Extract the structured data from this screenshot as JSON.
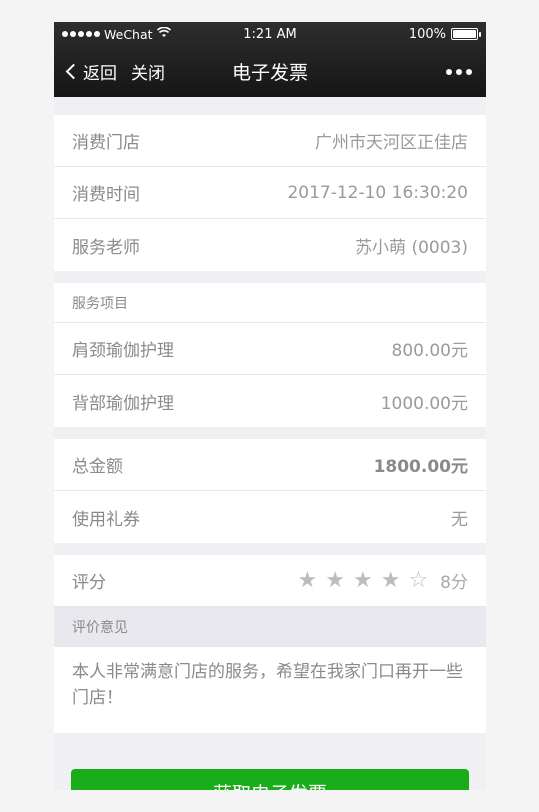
{
  "status_bar": {
    "carrier": "WeChat",
    "time": "1:21 AM",
    "battery": "100%"
  },
  "nav": {
    "back_label": "返回",
    "close_label": "关闭",
    "title": "电子发票"
  },
  "info": {
    "store_label": "消费门店",
    "store_value": "广州市天河区正佳店",
    "time_label": "消费时间",
    "time_value": "2017-12-10 16:30:20",
    "teacher_label": "服务老师",
    "teacher_value": "苏小萌 (0003)"
  },
  "services": {
    "header": "服务项目",
    "items": [
      {
        "name": "肩颈瑜伽护理",
        "price": "800.00元"
      },
      {
        "name": "背部瑜伽护理",
        "price": "1000.00元"
      }
    ]
  },
  "totals": {
    "total_label": "总金额",
    "total_value": "1800.00元",
    "coupon_label": "使用礼券",
    "coupon_value": "无"
  },
  "rating": {
    "label": "评分",
    "stars_filled": 4,
    "stars_total": 5,
    "score": "8分"
  },
  "review": {
    "header": "评价意见",
    "text": "本人非常满意门店的服务，希望在我家门口再开一些门店！"
  },
  "action": {
    "button_label": "获取电子发票"
  },
  "colors": {
    "accent": "#1aad19",
    "header_bg": "#1f1f1f"
  }
}
